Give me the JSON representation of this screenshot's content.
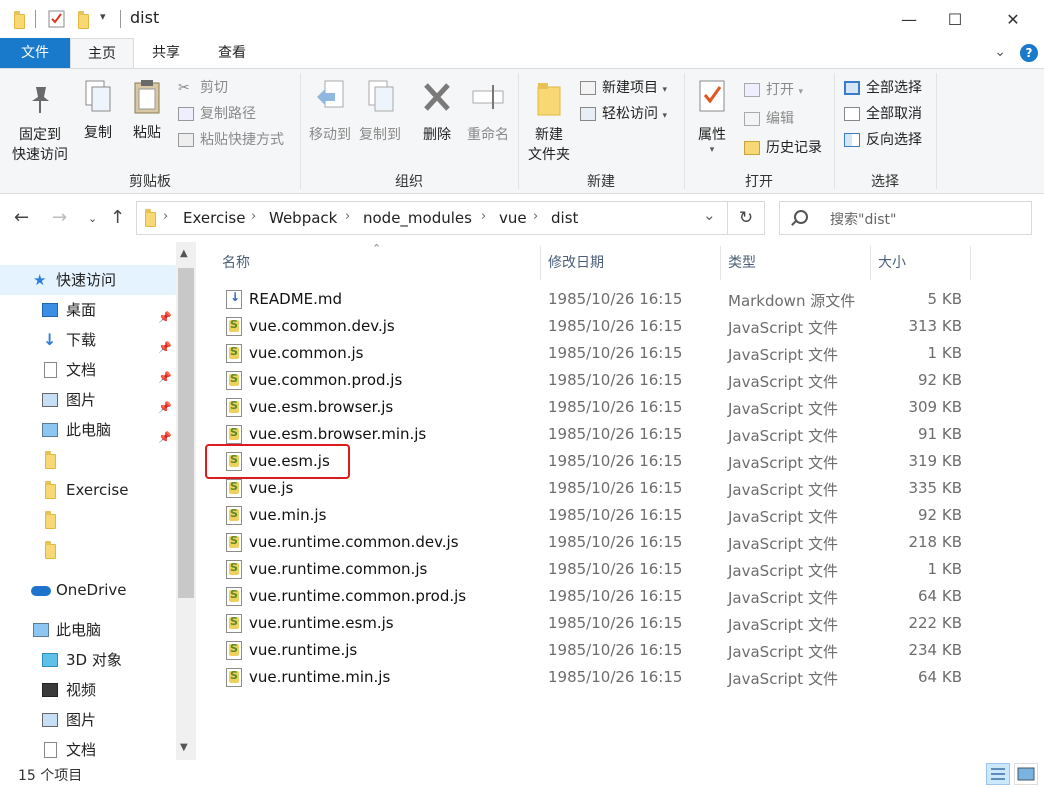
{
  "window": {
    "title": "dist",
    "minimize": "—",
    "maximize": "☐",
    "close": "✕"
  },
  "ribbon_tabs": [
    {
      "label": "文件"
    },
    {
      "label": "主页"
    },
    {
      "label": "共享"
    },
    {
      "label": "查看"
    }
  ],
  "ribbon": {
    "clipboard": {
      "label": "剪贴板",
      "pin": "固定到\n快速访问",
      "pin_line1": "固定到",
      "pin_line2": "快速访问",
      "copy": "复制",
      "paste": "粘贴",
      "cut": "剪切",
      "copy_path": "复制路径",
      "paste_shortcut": "粘贴快捷方式"
    },
    "organize": {
      "label": "组织",
      "move_to": "移动到",
      "copy_to": "复制到",
      "delete": "删除",
      "rename": "重命名"
    },
    "new": {
      "label": "新建",
      "new_folder_line1": "新建",
      "new_folder_line2": "文件夹",
      "new_item": "新建项目",
      "easy_access": "轻松访问"
    },
    "open": {
      "label": "打开",
      "properties": "属性",
      "open": "打开",
      "edit": "编辑",
      "history": "历史记录"
    },
    "select": {
      "label": "选择",
      "select_all": "全部选择",
      "select_none": "全部取消",
      "invert": "反向选择"
    }
  },
  "address": {
    "breadcrumbs": [
      "Exercise",
      "Webpack",
      "node_modules",
      "vue",
      "dist"
    ],
    "search_placeholder": "搜索\"dist\""
  },
  "nav": {
    "items": [
      {
        "label": "快速访问",
        "icon": "star-icon"
      },
      {
        "label": "桌面",
        "icon": "desktop-icon"
      },
      {
        "label": "下载",
        "icon": "download-icon"
      },
      {
        "label": "文档",
        "icon": "document-icon"
      },
      {
        "label": "图片",
        "icon": "picture-icon"
      },
      {
        "label": "此电脑",
        "icon": "computer-icon"
      },
      {
        "label": "",
        "icon": "folder-icon"
      },
      {
        "label": "Exercise",
        "icon": "folder-icon"
      },
      {
        "label": "",
        "icon": "folder-icon"
      },
      {
        "label": "",
        "icon": "folder-icon"
      },
      {
        "label": "OneDrive",
        "icon": "cloud-icon"
      },
      {
        "label": "此电脑",
        "icon": "computer-icon"
      },
      {
        "label": "3D 对象",
        "icon": "cube-icon"
      },
      {
        "label": "视频",
        "icon": "video-icon"
      },
      {
        "label": "图片",
        "icon": "picture-icon"
      },
      {
        "label": "文档",
        "icon": "document-icon"
      }
    ]
  },
  "columns": {
    "name": "名称",
    "date": "修改日期",
    "type": "类型",
    "size": "大小"
  },
  "files": [
    {
      "name": "README.md",
      "date": "1985/10/26 16:15",
      "type": "Markdown 源文件",
      "size": "5 KB"
    },
    {
      "name": "vue.common.dev.js",
      "date": "1985/10/26 16:15",
      "type": "JavaScript 文件",
      "size": "313 KB"
    },
    {
      "name": "vue.common.js",
      "date": "1985/10/26 16:15",
      "type": "JavaScript 文件",
      "size": "1 KB"
    },
    {
      "name": "vue.common.prod.js",
      "date": "1985/10/26 16:15",
      "type": "JavaScript 文件",
      "size": "92 KB"
    },
    {
      "name": "vue.esm.browser.js",
      "date": "1985/10/26 16:15",
      "type": "JavaScript 文件",
      "size": "309 KB"
    },
    {
      "name": "vue.esm.browser.min.js",
      "date": "1985/10/26 16:15",
      "type": "JavaScript 文件",
      "size": "91 KB"
    },
    {
      "name": "vue.esm.js",
      "date": "1985/10/26 16:15",
      "type": "JavaScript 文件",
      "size": "319 KB"
    },
    {
      "name": "vue.js",
      "date": "1985/10/26 16:15",
      "type": "JavaScript 文件",
      "size": "335 KB"
    },
    {
      "name": "vue.min.js",
      "date": "1985/10/26 16:15",
      "type": "JavaScript 文件",
      "size": "92 KB"
    },
    {
      "name": "vue.runtime.common.dev.js",
      "date": "1985/10/26 16:15",
      "type": "JavaScript 文件",
      "size": "218 KB"
    },
    {
      "name": "vue.runtime.common.js",
      "date": "1985/10/26 16:15",
      "type": "JavaScript 文件",
      "size": "1 KB"
    },
    {
      "name": "vue.runtime.common.prod.js",
      "date": "1985/10/26 16:15",
      "type": "JavaScript 文件",
      "size": "64 KB"
    },
    {
      "name": "vue.runtime.esm.js",
      "date": "1985/10/26 16:15",
      "type": "JavaScript 文件",
      "size": "222 KB"
    },
    {
      "name": "vue.runtime.js",
      "date": "1985/10/26 16:15",
      "type": "JavaScript 文件",
      "size": "234 KB"
    },
    {
      "name": "vue.runtime.min.js",
      "date": "1985/10/26 16:15",
      "type": "JavaScript 文件",
      "size": "64 KB"
    }
  ],
  "status": {
    "item_count": "15 个项目"
  },
  "colors": {
    "accent": "#1979ca",
    "highlight": "#e0191c",
    "selected": "#e5f3ff"
  }
}
